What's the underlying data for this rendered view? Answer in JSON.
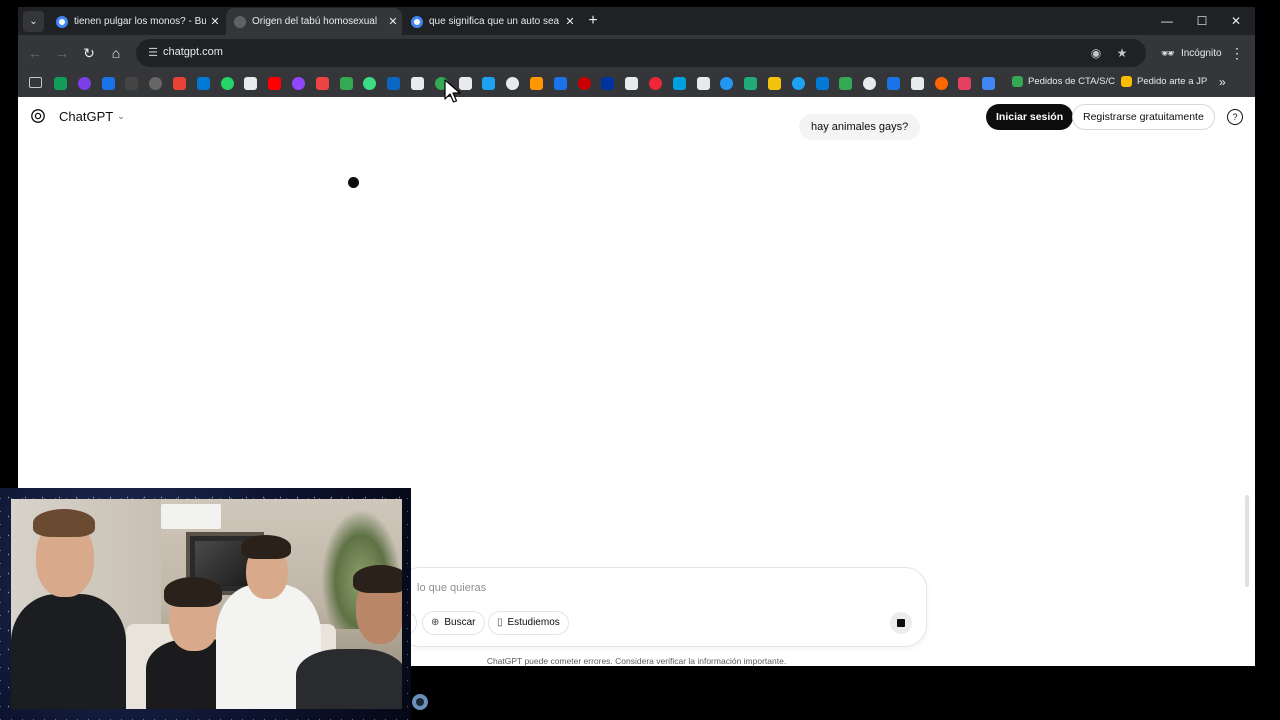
{
  "browser": {
    "tabs": [
      {
        "title": "tienen pulgar los monos? - Bus",
        "favicon_color": "#4285f4",
        "active": false
      },
      {
        "title": "Origen del tabú homosexual",
        "favicon_color": "#5f6368",
        "active": true
      },
      {
        "title": "que significa que un auto sea u",
        "favicon_color": "#4285f4",
        "active": false
      }
    ],
    "new_tab_glyph": "+",
    "url": "chatgpt.com",
    "incognito_label": "Incógnito",
    "bookmarks_text": [
      {
        "label": "Pedidos de CTA/S/C",
        "color": "#34a853"
      },
      {
        "label": "Pedido arte a JP",
        "color": "#fbbc04"
      }
    ],
    "bookmark_icon_colors": [
      "#0f9d58",
      "#7b3fe4",
      "#1a73e8",
      "#444",
      "#666",
      "#ea4335",
      "#0078d4",
      "#25d366",
      "#e8eaed",
      "#ff0000",
      "#9146ff",
      "#e44",
      "#34a853",
      "#3ddc84",
      "#0a66c2",
      "#e8eaed",
      "#34a853",
      "#e8eaed",
      "#1da1f2",
      "#e8eaed",
      "#ff9800",
      "#1a73e8",
      "#c00",
      "#0033a0",
      "#e8eaed",
      "#ee2737",
      "#00a0df",
      "#e8eaed",
      "#2196f3",
      "#2a7",
      "#f4c20d",
      "#1da1f2",
      "#0078d4",
      "#34a853",
      "#e8eaed",
      "#1a73e8",
      "#e8eaed",
      "#ff6600",
      "#e4405f",
      "#4285f4"
    ]
  },
  "chatgpt": {
    "brand": "ChatGPT",
    "user_message": "hay animales gays?",
    "login_label": "Iniciar sesión",
    "signup_label": "Registrarse gratuitamente",
    "help_glyph": "?",
    "input_placeholder": "lo que quieras",
    "chip_partial": "ar",
    "chip_search": "Buscar",
    "chip_study": "Estudiemos",
    "disclaimer": "ChatGPT puede cometer errores. Considera verificar la información importante."
  }
}
